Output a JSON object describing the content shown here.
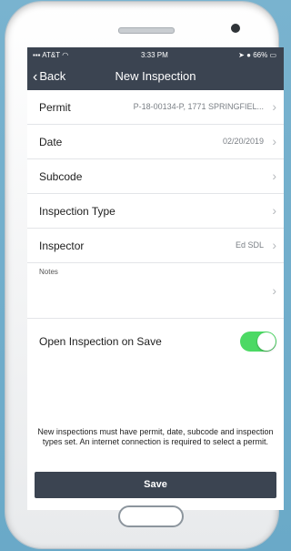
{
  "status_bar": {
    "carrier": "AT&T",
    "time": "3:33 PM",
    "battery": "66%"
  },
  "nav": {
    "back_label": "Back",
    "title": "New Inspection"
  },
  "fields": [
    {
      "label": "Permit",
      "value": "P-18-00134-P, 1771 SPRINGFIEL..."
    },
    {
      "label": "Date",
      "value": "02/20/2019"
    },
    {
      "label": "Subcode",
      "value": ""
    },
    {
      "label": "Inspection Type",
      "value": ""
    },
    {
      "label": "Inspector",
      "value": "Ed SDL"
    }
  ],
  "notes_label": "Notes",
  "open_on_save": {
    "label": "Open Inspection on Save",
    "state": "on"
  },
  "footnote": "New inspections must have permit, date, subcode and inspection types set. An internet connection is required to select a permit.",
  "save_label": "Save",
  "colors": {
    "navbar": "#3b4451",
    "toggle_on": "#4cd964",
    "background": "#79b3cf"
  }
}
